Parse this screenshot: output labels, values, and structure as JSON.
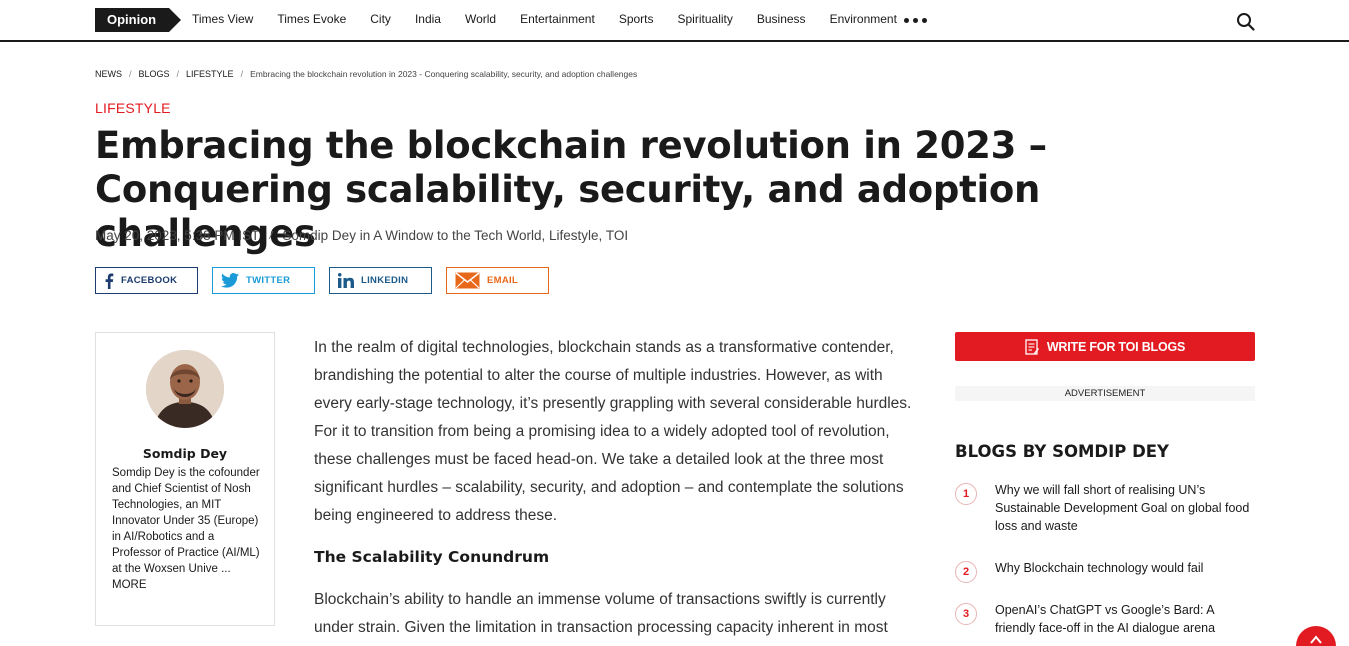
{
  "nav": {
    "opinion": "Opinion",
    "items": [
      "Times View",
      "Times Evoke",
      "City",
      "India",
      "World",
      "Entertainment",
      "Sports",
      "Spirituality",
      "Business",
      "Environment"
    ]
  },
  "breadcrumb": {
    "items": [
      "NEWS",
      "BLOGS",
      "LIFESTYLE"
    ],
    "current": "Embracing the blockchain revolution in 2023 - Conquering scalability, security, and adoption challenges"
  },
  "article": {
    "category": "LIFESTYLE",
    "title": "Embracing the blockchain revolution in 2023 – Conquering scalability, security, and adoption challenges",
    "date": "May 20, 2023, 5:38 PM IST",
    "author_line": "Somdip Dey in A Window to the Tech World, Lifestyle, TOI",
    "paragraph_1": "In the realm of digital technologies, blockchain stands as a transformative contender, brandishing the potential to alter the course of multiple industries. However, as with every early-stage technology, it’s presently grappling with several considerable hurdles. For it to transition from being a promising idea to a widely adopted tool of revolution, these challenges must be faced head-on. We take a detailed look at the three most significant hurdles – scalability, security, and adoption – and contemplate the solutions being engineered to address these.",
    "heading_1": "The Scalability Conundrum",
    "paragraph_2": "Blockchain’s ability to handle an immense volume of transactions swiftly is currently under strain. Given the limitation in transaction processing capacity inherent in most"
  },
  "share": {
    "facebook": "FACEBOOK",
    "twitter": "TWITTER",
    "linkedin": "LINKEDIN",
    "email": "EMAIL"
  },
  "author": {
    "name": "Somdip Dey",
    "bio": "Somdip Dey is the cofounder and Chief Scientist of Nosh Technologies, an MIT Innovator Under 35 (Europe) in AI/Robotics and a Professor of Practice (AI/ML) at the Woxsen Unive",
    "more": "... MORE"
  },
  "sidebar": {
    "write_button": "WRITE FOR TOI BLOGS",
    "ad_label": "ADVERTISEMENT",
    "blogs_title": "BLOGS BY SOMDIP DEY",
    "blogs": [
      {
        "num": "1",
        "title": "Why we will fall short of realising UN’s Sustainable Development Goal on global food loss and waste"
      },
      {
        "num": "2",
        "title": "Why Blockchain technology would fail"
      },
      {
        "num": "3",
        "title": "OpenAI’s ChatGPT vs Google’s Bard: A friendly face-off in the AI dialogue arena"
      }
    ]
  },
  "colors": {
    "accent": "#e21b22",
    "facebook": "#1c3b6e",
    "twitter": "#1a9bd7",
    "linkedin": "#1c5a8a",
    "email": "#e8681a"
  }
}
